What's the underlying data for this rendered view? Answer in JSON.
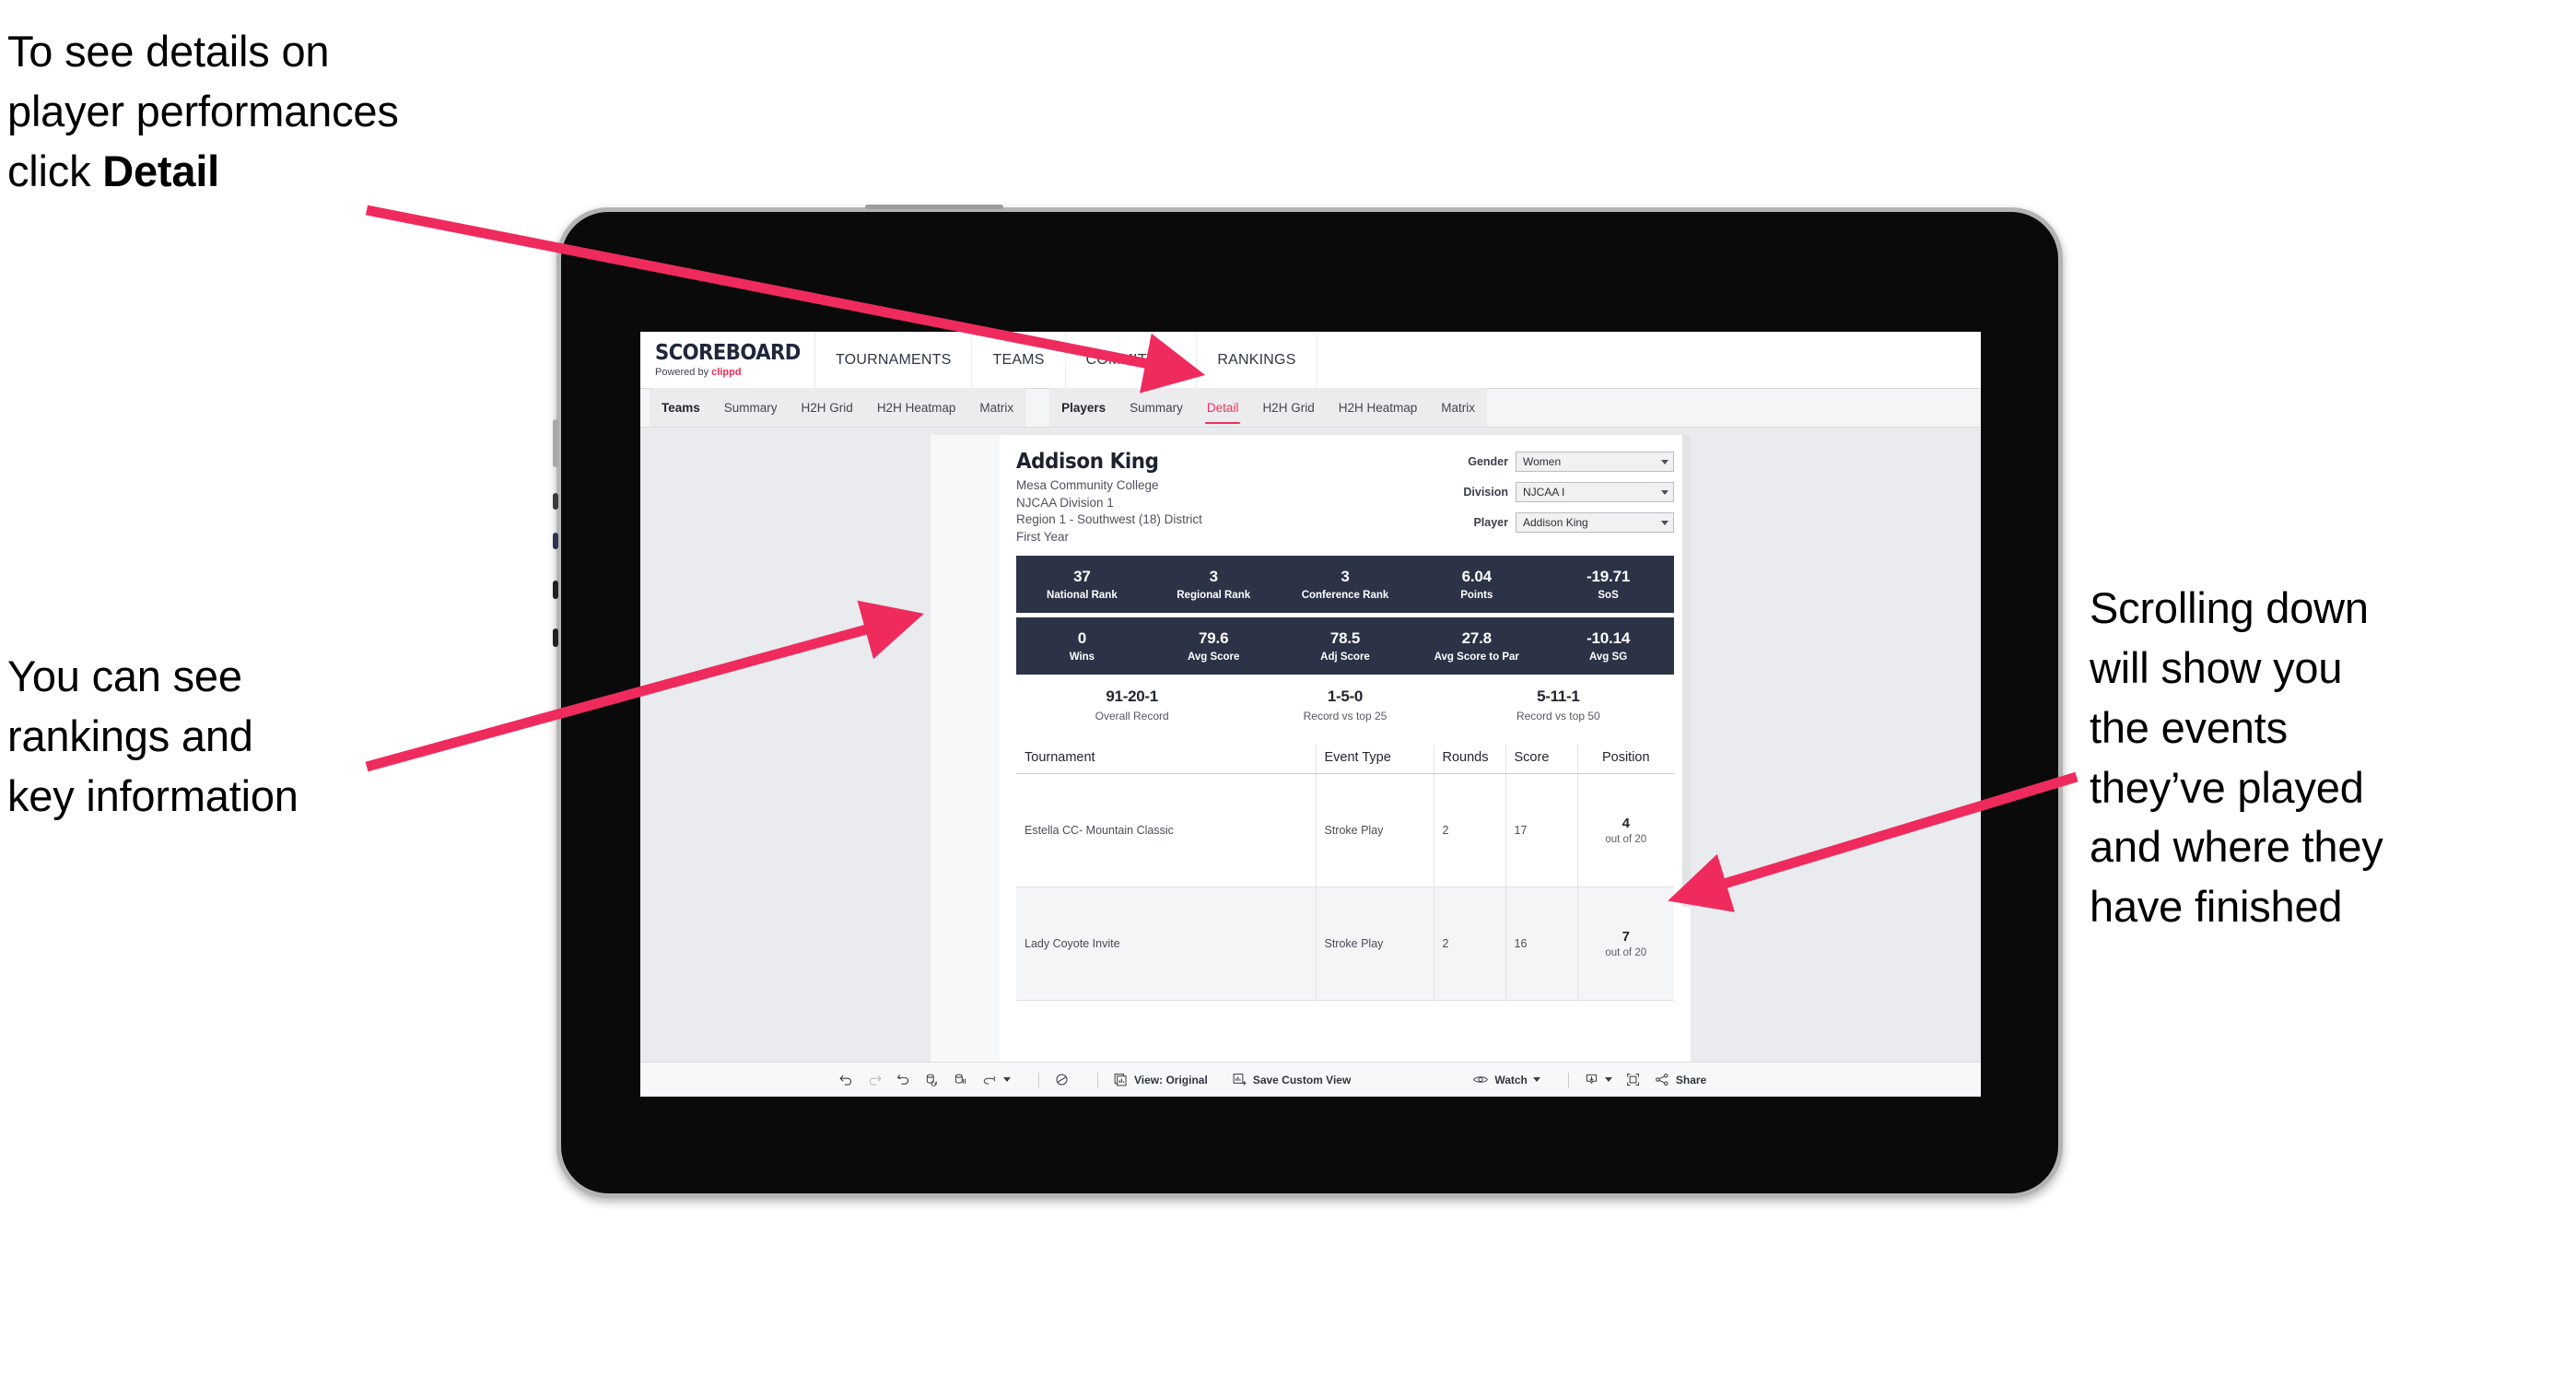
{
  "annotations": {
    "top_left": "To see details on\nplayer performances\nclick ",
    "top_left_bold": "Detail",
    "mid_left": "You can see\nrankings and\nkey information",
    "right": "Scrolling down\nwill show you\nthe events\nthey’ve played\nand where they\nhave finished"
  },
  "colors": {
    "accent_pink": "#f0315c",
    "stat_bar_navy": "#2c3347",
    "arrow_pink": "#ef2b5e",
    "page_bg": "#e9ebee"
  },
  "site": {
    "brand_title": "SCOREBOARD",
    "brand_sub_prefix": "Powered by ",
    "brand_sub_name": "clippd",
    "nav": [
      {
        "label": "TOURNAMENTS"
      },
      {
        "label": "TEAMS"
      },
      {
        "label": "COMMITTEE"
      },
      {
        "label": "RANKINGS"
      }
    ]
  },
  "tabs": {
    "group_teams": [
      {
        "label": "Teams",
        "lead": true,
        "active": false
      },
      {
        "label": "Summary",
        "lead": false,
        "active": false
      },
      {
        "label": "H2H Grid",
        "lead": false,
        "active": false
      },
      {
        "label": "H2H Heatmap",
        "lead": false,
        "active": false
      },
      {
        "label": "Matrix",
        "lead": false,
        "active": false
      }
    ],
    "group_players": [
      {
        "label": "Players",
        "lead": true,
        "active": false
      },
      {
        "label": "Summary",
        "lead": false,
        "active": false
      },
      {
        "label": "Detail",
        "lead": false,
        "active": true
      },
      {
        "label": "H2H Grid",
        "lead": false,
        "active": false
      },
      {
        "label": "H2H Heatmap",
        "lead": false,
        "active": false
      },
      {
        "label": "Matrix",
        "lead": false,
        "active": false
      }
    ]
  },
  "player": {
    "name": "Addison King",
    "meta": [
      "Mesa Community College",
      "NJCAA Division 1",
      "Region 1 - Southwest (18) District",
      "First Year"
    ]
  },
  "filters": [
    {
      "label": "Gender",
      "value": "Women"
    },
    {
      "label": "Division",
      "value": "NJCAA I"
    },
    {
      "label": "Player",
      "value": "Addison King"
    }
  ],
  "stats_row_1": [
    {
      "value": "37",
      "label": "National Rank"
    },
    {
      "value": "3",
      "label": "Regional Rank"
    },
    {
      "value": "3",
      "label": "Conference Rank"
    },
    {
      "value": "6.04",
      "label": "Points"
    },
    {
      "value": "-19.71",
      "label": "SoS"
    }
  ],
  "stats_row_2": [
    {
      "value": "0",
      "label": "Wins"
    },
    {
      "value": "79.6",
      "label": "Avg Score"
    },
    {
      "value": "78.5",
      "label": "Adj Score"
    },
    {
      "value": "27.8",
      "label": "Avg Score to Par"
    },
    {
      "value": "-10.14",
      "label": "Avg SG"
    }
  ],
  "records": [
    {
      "value": "91-20-1",
      "label": "Overall Record"
    },
    {
      "value": "1-5-0",
      "label": "Record vs top 25"
    },
    {
      "value": "5-11-1",
      "label": "Record vs top 50"
    }
  ],
  "table": {
    "headers": [
      "Tournament",
      "Event Type",
      "Rounds",
      "Score",
      "Position"
    ],
    "rows": [
      {
        "tournament": "Estella CC- Mountain Classic",
        "event_type": "Stroke Play",
        "rounds": "2",
        "score": "17",
        "position_value": "4",
        "position_label": "out of 20"
      },
      {
        "tournament": "Lady Coyote Invite",
        "event_type": "Stroke Play",
        "rounds": "2",
        "score": "16",
        "position_value": "7",
        "position_label": "out of 20"
      }
    ]
  },
  "toolbar": {
    "view_label": "View: Original",
    "save_label": "Save Custom View",
    "watch_label": "Watch",
    "share_label": "Share"
  }
}
